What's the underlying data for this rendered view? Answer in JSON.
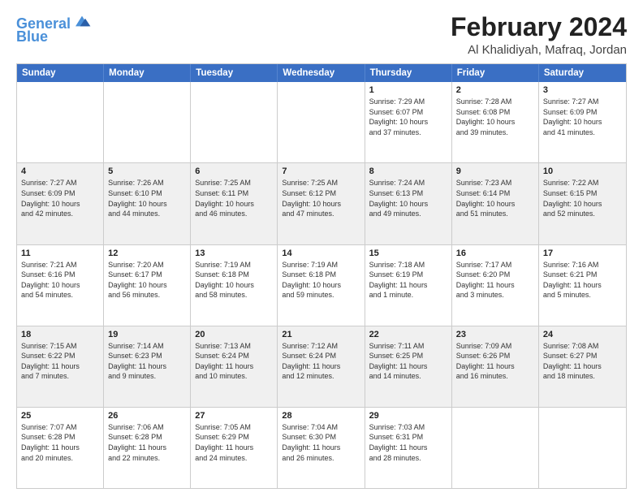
{
  "header": {
    "logo_line1": "General",
    "logo_line2": "Blue",
    "title": "February 2024",
    "subtitle": "Al Khalidiyah, Mafraq, Jordan"
  },
  "weekdays": [
    "Sunday",
    "Monday",
    "Tuesday",
    "Wednesday",
    "Thursday",
    "Friday",
    "Saturday"
  ],
  "rows": [
    [
      {
        "day": "",
        "info": ""
      },
      {
        "day": "",
        "info": ""
      },
      {
        "day": "",
        "info": ""
      },
      {
        "day": "",
        "info": ""
      },
      {
        "day": "1",
        "info": "Sunrise: 7:29 AM\nSunset: 6:07 PM\nDaylight: 10 hours\nand 37 minutes."
      },
      {
        "day": "2",
        "info": "Sunrise: 7:28 AM\nSunset: 6:08 PM\nDaylight: 10 hours\nand 39 minutes."
      },
      {
        "day": "3",
        "info": "Sunrise: 7:27 AM\nSunset: 6:09 PM\nDaylight: 10 hours\nand 41 minutes."
      }
    ],
    [
      {
        "day": "4",
        "info": "Sunrise: 7:27 AM\nSunset: 6:09 PM\nDaylight: 10 hours\nand 42 minutes."
      },
      {
        "day": "5",
        "info": "Sunrise: 7:26 AM\nSunset: 6:10 PM\nDaylight: 10 hours\nand 44 minutes."
      },
      {
        "day": "6",
        "info": "Sunrise: 7:25 AM\nSunset: 6:11 PM\nDaylight: 10 hours\nand 46 minutes."
      },
      {
        "day": "7",
        "info": "Sunrise: 7:25 AM\nSunset: 6:12 PM\nDaylight: 10 hours\nand 47 minutes."
      },
      {
        "day": "8",
        "info": "Sunrise: 7:24 AM\nSunset: 6:13 PM\nDaylight: 10 hours\nand 49 minutes."
      },
      {
        "day": "9",
        "info": "Sunrise: 7:23 AM\nSunset: 6:14 PM\nDaylight: 10 hours\nand 51 minutes."
      },
      {
        "day": "10",
        "info": "Sunrise: 7:22 AM\nSunset: 6:15 PM\nDaylight: 10 hours\nand 52 minutes."
      }
    ],
    [
      {
        "day": "11",
        "info": "Sunrise: 7:21 AM\nSunset: 6:16 PM\nDaylight: 10 hours\nand 54 minutes."
      },
      {
        "day": "12",
        "info": "Sunrise: 7:20 AM\nSunset: 6:17 PM\nDaylight: 10 hours\nand 56 minutes."
      },
      {
        "day": "13",
        "info": "Sunrise: 7:19 AM\nSunset: 6:18 PM\nDaylight: 10 hours\nand 58 minutes."
      },
      {
        "day": "14",
        "info": "Sunrise: 7:19 AM\nSunset: 6:18 PM\nDaylight: 10 hours\nand 59 minutes."
      },
      {
        "day": "15",
        "info": "Sunrise: 7:18 AM\nSunset: 6:19 PM\nDaylight: 11 hours\nand 1 minute."
      },
      {
        "day": "16",
        "info": "Sunrise: 7:17 AM\nSunset: 6:20 PM\nDaylight: 11 hours\nand 3 minutes."
      },
      {
        "day": "17",
        "info": "Sunrise: 7:16 AM\nSunset: 6:21 PM\nDaylight: 11 hours\nand 5 minutes."
      }
    ],
    [
      {
        "day": "18",
        "info": "Sunrise: 7:15 AM\nSunset: 6:22 PM\nDaylight: 11 hours\nand 7 minutes."
      },
      {
        "day": "19",
        "info": "Sunrise: 7:14 AM\nSunset: 6:23 PM\nDaylight: 11 hours\nand 9 minutes."
      },
      {
        "day": "20",
        "info": "Sunrise: 7:13 AM\nSunset: 6:24 PM\nDaylight: 11 hours\nand 10 minutes."
      },
      {
        "day": "21",
        "info": "Sunrise: 7:12 AM\nSunset: 6:24 PM\nDaylight: 11 hours\nand 12 minutes."
      },
      {
        "day": "22",
        "info": "Sunrise: 7:11 AM\nSunset: 6:25 PM\nDaylight: 11 hours\nand 14 minutes."
      },
      {
        "day": "23",
        "info": "Sunrise: 7:09 AM\nSunset: 6:26 PM\nDaylight: 11 hours\nand 16 minutes."
      },
      {
        "day": "24",
        "info": "Sunrise: 7:08 AM\nSunset: 6:27 PM\nDaylight: 11 hours\nand 18 minutes."
      }
    ],
    [
      {
        "day": "25",
        "info": "Sunrise: 7:07 AM\nSunset: 6:28 PM\nDaylight: 11 hours\nand 20 minutes."
      },
      {
        "day": "26",
        "info": "Sunrise: 7:06 AM\nSunset: 6:28 PM\nDaylight: 11 hours\nand 22 minutes."
      },
      {
        "day": "27",
        "info": "Sunrise: 7:05 AM\nSunset: 6:29 PM\nDaylight: 11 hours\nand 24 minutes."
      },
      {
        "day": "28",
        "info": "Sunrise: 7:04 AM\nSunset: 6:30 PM\nDaylight: 11 hours\nand 26 minutes."
      },
      {
        "day": "29",
        "info": "Sunrise: 7:03 AM\nSunset: 6:31 PM\nDaylight: 11 hours\nand 28 minutes."
      },
      {
        "day": "",
        "info": ""
      },
      {
        "day": "",
        "info": ""
      }
    ]
  ]
}
